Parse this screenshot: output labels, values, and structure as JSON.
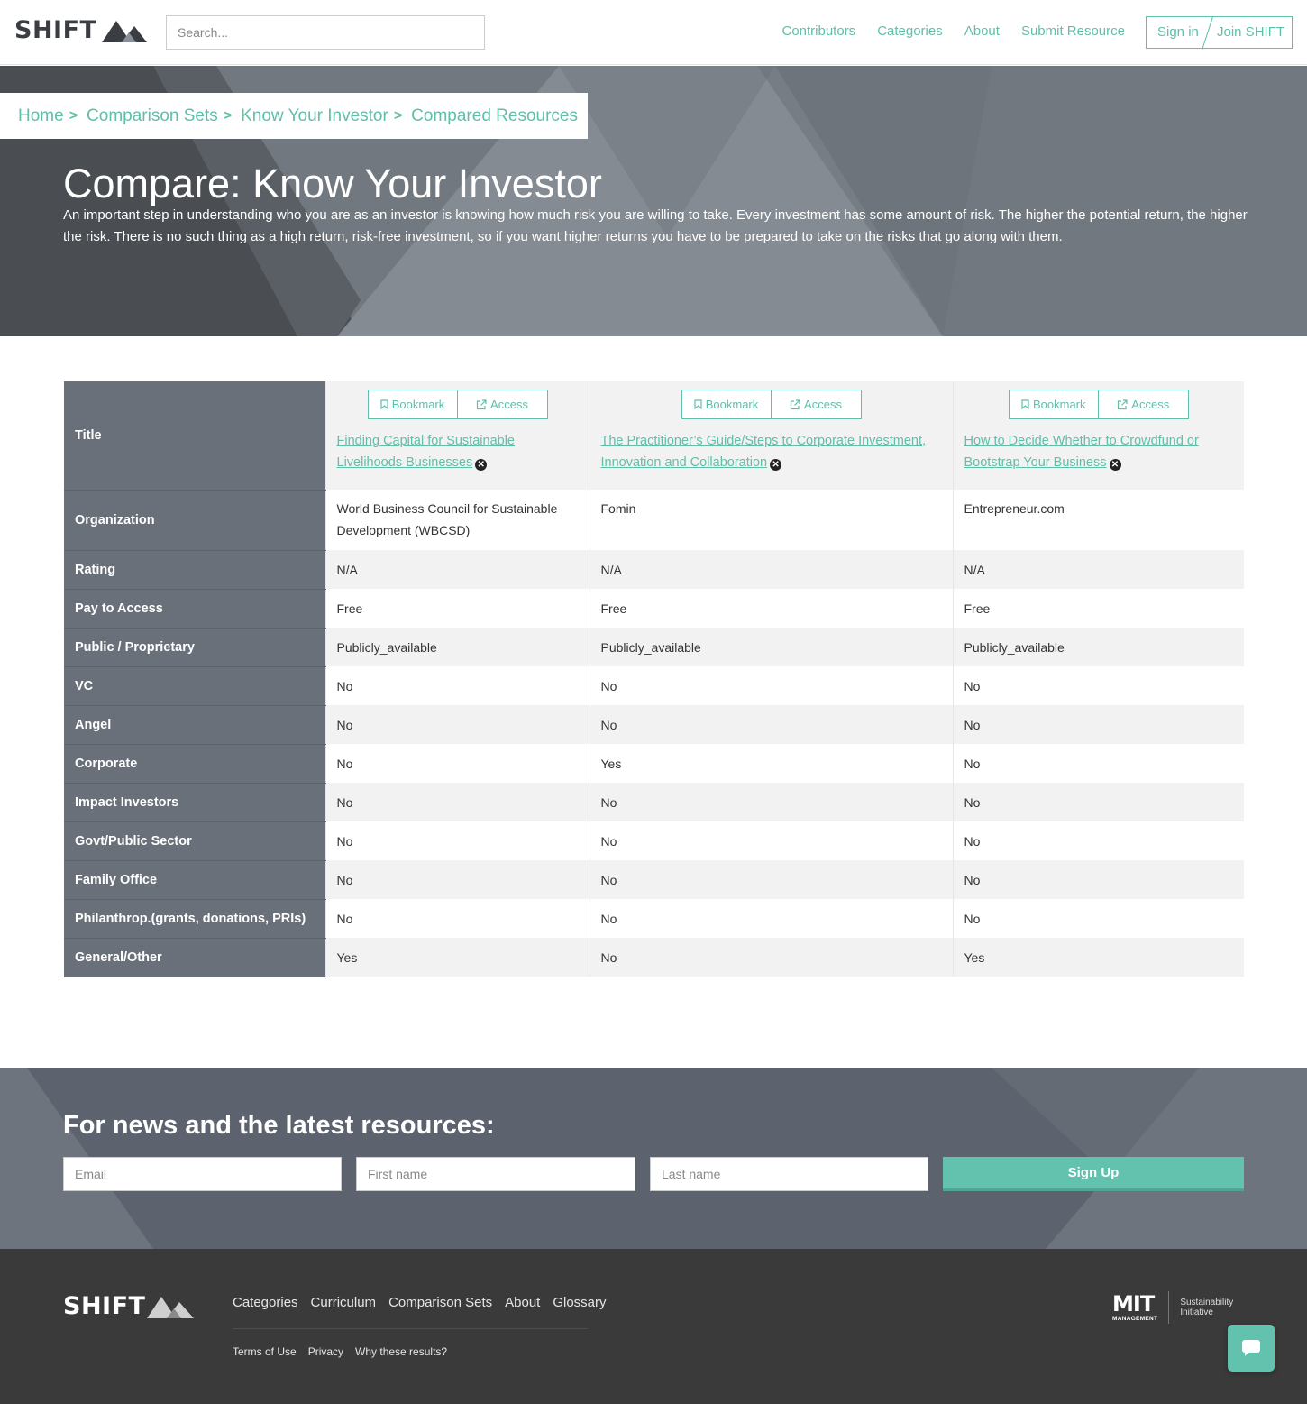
{
  "header": {
    "logo_text": "SHIFT",
    "search_placeholder": "Search...",
    "nav": [
      "Contributors",
      "Categories",
      "About",
      "Submit Resource"
    ],
    "sign_in": "Sign in",
    "join": "Join SHIFT"
  },
  "breadcrumb": [
    "Home",
    "Comparison Sets",
    "Know Your Investor",
    "Compared Resources"
  ],
  "breadcrumb_sep": ">",
  "hero": {
    "title": "Compare: Know Your Investor",
    "description": "An important step in understanding who you are as an investor is knowing how much risk you are willing to take. Every investment has some amount of risk. The higher the potential return, the higher the risk. There is no such thing as a high return, risk-free investment, so if you want higher returns you have to be prepared to take on the risks that go along with them."
  },
  "table": {
    "bookmark_label": "Bookmark",
    "access_label": "Access",
    "row_labels": {
      "title": "Title",
      "organization": "Organization",
      "rating": "Rating",
      "pay": "Pay to Access",
      "public": "Public / Proprietary",
      "vc": "VC",
      "angel": "Angel",
      "corporate": "Corporate",
      "impact": "Impact Investors",
      "govt": "Govt/Public Sector",
      "family": "Family Office",
      "philanthrop": "Philanthrop.(grants, donations, PRIs)",
      "general": "General/Other"
    },
    "resources": [
      {
        "title": "Finding Capital for Sustainable Livelihoods Businesses",
        "organization": "World Business Council for Sustainable Development (WBCSD)",
        "rating": "N/A",
        "pay": "Free",
        "public": "Publicly_available",
        "vc": "No",
        "angel": "No",
        "corporate": "No",
        "impact": "No",
        "govt": "No",
        "family": "No",
        "philanthrop": "No",
        "general": "Yes"
      },
      {
        "title": "The Practitioner’s Guide/Steps to Corporate Investment, Innovation and Collaboration",
        "organization": "Fomin",
        "rating": "N/A",
        "pay": "Free",
        "public": "Publicly_available",
        "vc": "No",
        "angel": "No",
        "corporate": "Yes",
        "impact": "No",
        "govt": "No",
        "family": "No",
        "philanthrop": "No",
        "general": "No"
      },
      {
        "title": "How to Decide Whether to Crowdfund or Bootstrap Your Business",
        "organization": "Entrepreneur.com",
        "rating": "N/A",
        "pay": "Free",
        "public": "Publicly_available",
        "vc": "No",
        "angel": "No",
        "corporate": "No",
        "impact": "No",
        "govt": "No",
        "family": "No",
        "philanthrop": "No",
        "general": "Yes"
      }
    ]
  },
  "newsletter": {
    "heading": "For news and the latest resources:",
    "email_placeholder": "Email",
    "first_placeholder": "First name",
    "last_placeholder": "Last name",
    "signup_label": "Sign Up"
  },
  "footer": {
    "logo_text": "SHIFT",
    "links": [
      "Categories",
      "Curriculum",
      "Comparison Sets",
      "About",
      "Glossary"
    ],
    "sub_links": [
      "Terms of Use",
      "Privacy",
      "Why these results?"
    ],
    "mit_word": "MIT",
    "mit_sub": "MANAGEMENT",
    "mit_right_1": "Sustainability",
    "mit_right_2": "Initiative"
  },
  "colors": {
    "accent": "#5fbfa9",
    "header_cell": "#6a7079",
    "hero": "#72787f",
    "footer": "#3a3a3a"
  },
  "icons": [
    "mountain-logo-icon",
    "bookmark-icon",
    "external-link-icon",
    "remove-circle-icon",
    "chat-icon"
  ]
}
